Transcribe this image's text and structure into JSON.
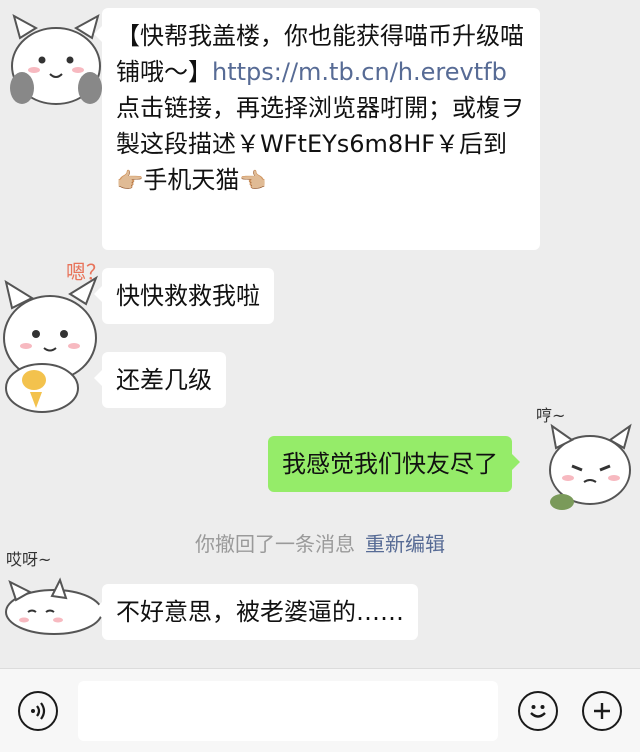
{
  "messages": {
    "m1": {
      "part1": "【快帮我盖楼，你也能获得喵币升级喵铺哦～】",
      "link": "https://m.tb.cn/h.erevtfb",
      "part2": " 点击链接，再选择浏览器咑開；或椱ヲ製这段描述￥WFtEYs6m8HF￥后到",
      "emoji1": "👉🏼",
      "part3": "手机天猫",
      "emoji2": "👈🏼"
    },
    "m2": "快快救救我啦",
    "m3": "还差几级",
    "m4": "我感觉我们快友尽了",
    "recall_text": "你撤回了一条消息",
    "recall_edit": "重新编辑",
    "m5": "不好意思，被老婆逼的……"
  },
  "stickers": {
    "s2_text": "嗯？",
    "s4_text": "哼~",
    "s5_text": "哎呀~"
  },
  "colors": {
    "background": "#ededed",
    "bubble_incoming": "#ffffff",
    "bubble_outgoing": "#95ec69",
    "link": "#576b95"
  },
  "inputbar": {
    "voice_icon": "voice-icon",
    "emoji_icon": "smiley-icon",
    "plus_icon": "plus-icon"
  }
}
